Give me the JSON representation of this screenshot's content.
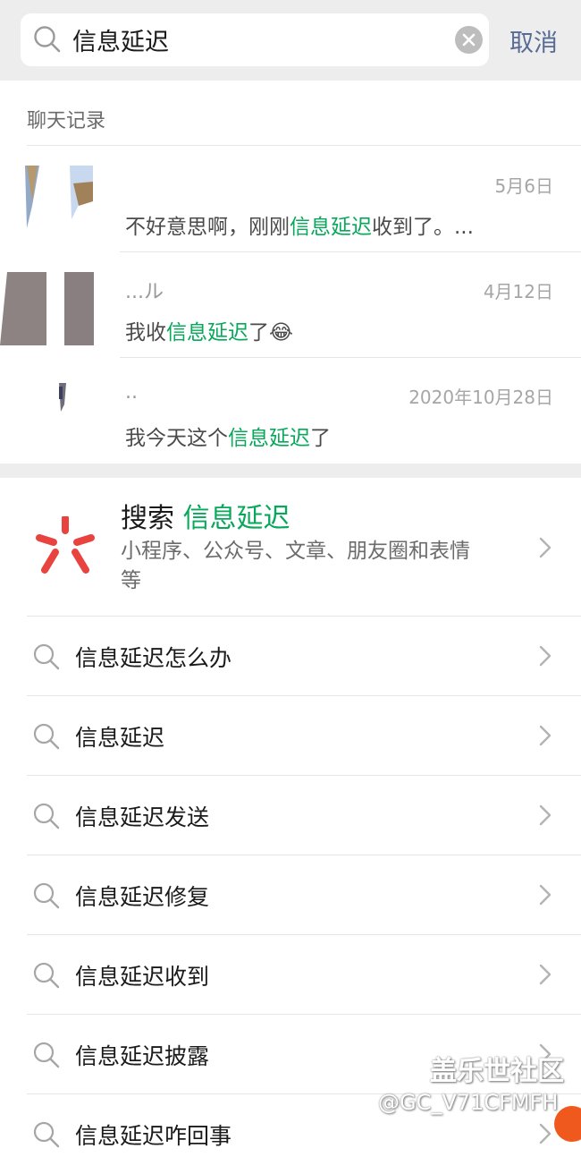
{
  "search": {
    "query": "信息延迟",
    "cancel_label": "取消"
  },
  "chat_records": {
    "section_title": "聊天记录",
    "items": [
      {
        "name": "",
        "date": "5月6日",
        "before": "不好意思啊，刚刚",
        "highlight": "信息延迟",
        "after": "收到了。..."
      },
      {
        "name": "...ル",
        "date": "4月12日",
        "before": "我收",
        "highlight": "信息延迟",
        "after": "了😂"
      },
      {
        "name": "..",
        "date": "2020年10月28日",
        "before": "我今天这个",
        "highlight": "信息延迟",
        "after": "了"
      }
    ]
  },
  "search_card": {
    "title_prefix": "搜索",
    "title_highlight": "信息延迟",
    "subtitle": "小程序、公众号、文章、朋友圈和表情等"
  },
  "suggestions": [
    "信息延迟怎么办",
    "信息延迟",
    "信息延迟发送",
    "信息延迟修复",
    "信息延迟收到",
    "信息延迟披露",
    "信息延迟咋回事"
  ],
  "watermark": {
    "site": "盖乐世社区",
    "user": "@GC_V71CFMFH"
  },
  "colors": {
    "highlight": "#07a85a",
    "cancel": "#576b95",
    "header_bg": "#ededed",
    "logo_red": "#e9433f"
  }
}
